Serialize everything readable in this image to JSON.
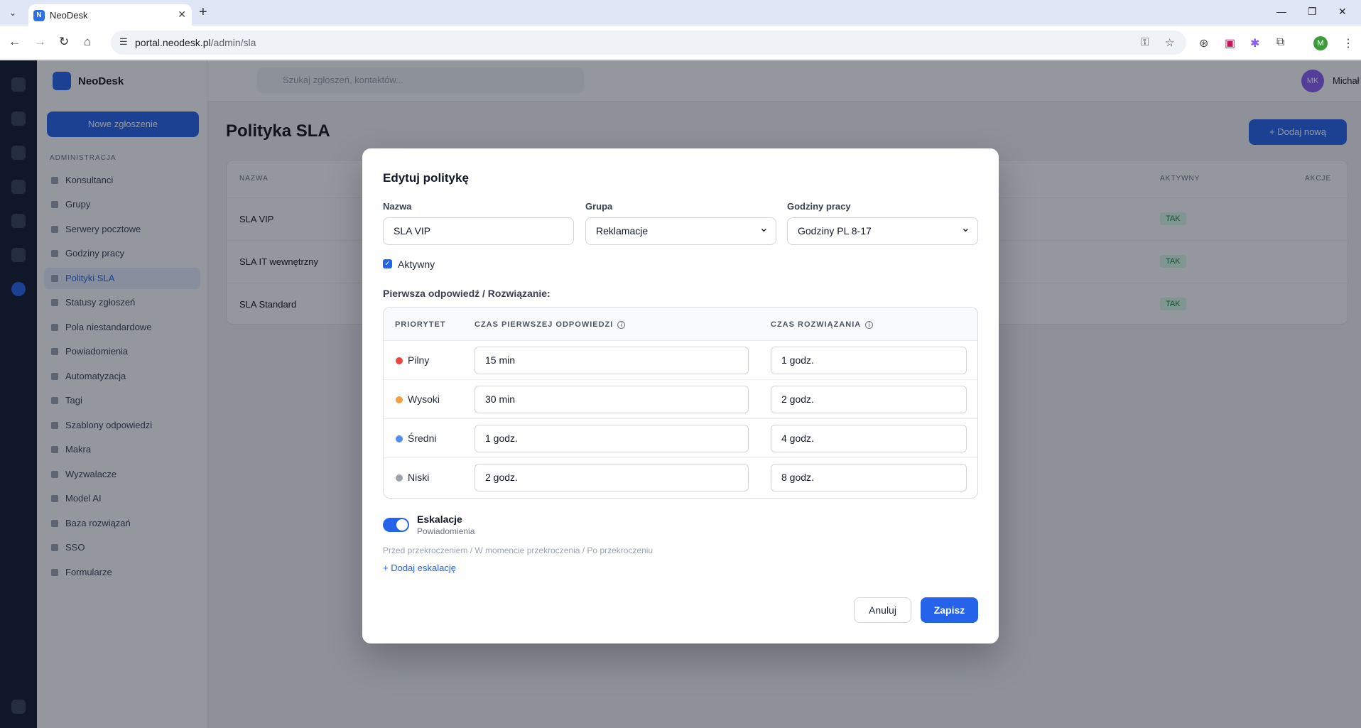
{
  "browser": {
    "tab_title": "NeoDesk",
    "tab_favicon": "N",
    "url_host": "portal.neodesk.pl",
    "url_path": "/admin/sla",
    "profile_initial": "M"
  },
  "app": {
    "brand": "NeoDesk",
    "new_ticket_label": "Nowe zgłoszenie",
    "sidebar_heading": "ADMINISTRACJA",
    "sidebar_items": [
      "Konsultanci",
      "Grupy",
      "Serwery pocztowe",
      "Godziny pracy",
      "Polityki SLA",
      "Statusy zgłoszeń",
      "Pola niestandardowe",
      "Powiadomienia",
      "Automatyzacja",
      "Tagi",
      "Szablony odpowiedzi",
      "Makra",
      "Wyzwalacze",
      "Model AI",
      "Baza rozwiązań",
      "SSO",
      "Formularze"
    ],
    "search_placeholder": "Szukaj zgłoszeń, kontaktów...",
    "user_name": "Michał",
    "user_initials": "MK",
    "page_title": "Polityka SLA",
    "add_button": "+ Dodaj nową",
    "table_headers": [
      "NAZWA",
      "AKTYWNY",
      "AKCJE"
    ],
    "rows": [
      {
        "name": "SLA VIP",
        "active": "TAK"
      },
      {
        "name": "SLA IT wewnętrzny",
        "active": "TAK"
      },
      {
        "name": "SLA Standard",
        "active": "TAK"
      }
    ]
  },
  "modal": {
    "title": "Edytuj politykę",
    "name_label": "Nazwa",
    "name_value": "SLA VIP",
    "group_label": "Grupa",
    "group_value": "Reklamacje",
    "hours_label": "Godziny pracy",
    "hours_value": "Godziny PL 8-17",
    "active_label": "Aktywny",
    "active_checked": true,
    "section_title": "Pierwsza odpowiedź / Rozwiązanie:",
    "headers": {
      "priority": "PRIORYTET",
      "first_response": "CZAS PIERWSZEJ ODPOWIEDZI",
      "resolution": "CZAS ROZWIĄZANIA"
    },
    "priorities": [
      {
        "name": "Pilny",
        "color": "#ef4444",
        "first_response": "15 min",
        "resolution": "1 godz."
      },
      {
        "name": "Wysoki",
        "color": "#f59e42",
        "first_response": "30 min",
        "resolution": "2 godz."
      },
      {
        "name": "Średni",
        "color": "#4f8ef7",
        "first_response": "1 godz.",
        "resolution": "4 godz."
      },
      {
        "name": "Niski",
        "color": "#9ca3af",
        "first_response": "2 godz.",
        "resolution": "8 godz."
      }
    ],
    "escalation_title": "Eskalacje",
    "escalation_subtitle": "Powiadomienia",
    "escalation_enabled": true,
    "escalation_hint": "Przed przekroczeniem / W momencie przekroczenia / Po przekroczeniu",
    "add_escalation": "+ Dodaj eskalację",
    "cancel": "Anuluj",
    "save": "Zapisz"
  },
  "colors": {
    "accent": "#2563eb"
  }
}
